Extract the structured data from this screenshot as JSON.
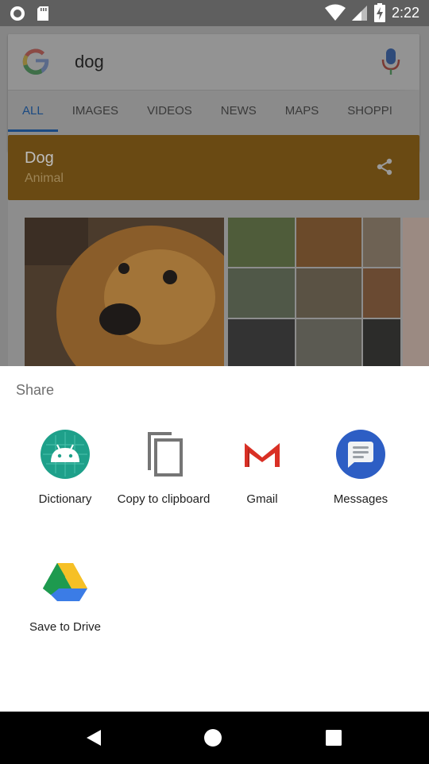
{
  "status_bar": {
    "time": "2:22"
  },
  "search": {
    "query": "dog",
    "tabs": [
      "ALL",
      "IMAGES",
      "VIDEOS",
      "NEWS",
      "MAPS",
      "SHOPPI"
    ]
  },
  "knowledge_card": {
    "title": "Dog",
    "subtitle": "Animal"
  },
  "share_sheet": {
    "title": "Share",
    "targets": [
      {
        "label": "Dictionary",
        "icon": "android-icon"
      },
      {
        "label": "Copy to clipboard",
        "icon": "copy-icon"
      },
      {
        "label": "Gmail",
        "icon": "gmail-icon"
      },
      {
        "label": "Messages",
        "icon": "messages-icon"
      },
      {
        "label": "Save to Drive",
        "icon": "drive-icon"
      }
    ]
  },
  "colors": {
    "sheet_bg": "#ffffff",
    "active_tab": "#1b4a82",
    "knowledge_card_bg": "#6a4a13",
    "navbar_bg": "#000000"
  }
}
